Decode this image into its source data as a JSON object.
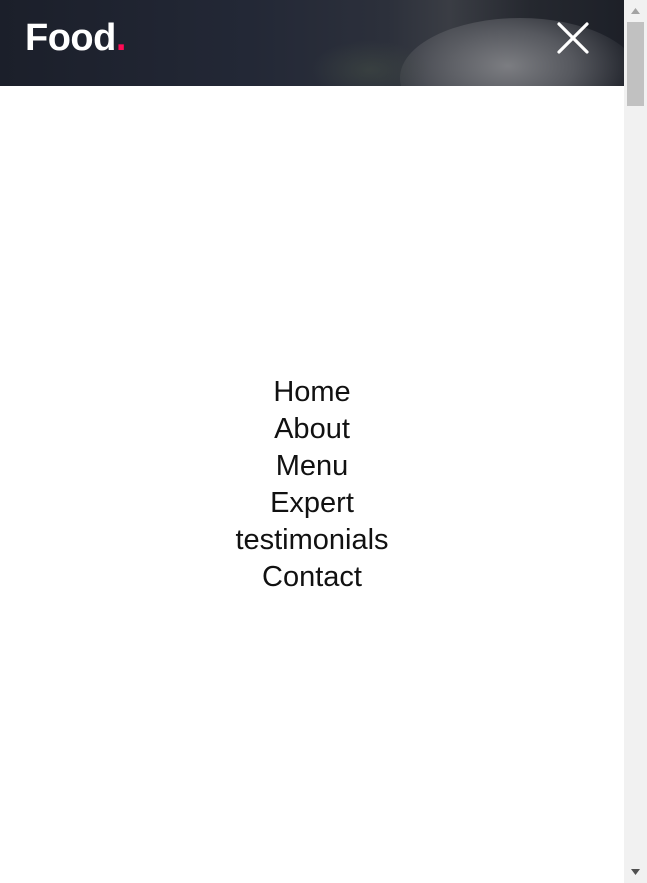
{
  "header": {
    "logo_text": "Food",
    "logo_dot": ".",
    "accent_color": "#ff0b55",
    "close_icon": "close-icon"
  },
  "nav": {
    "items": [
      {
        "label": "Home"
      },
      {
        "label": "About"
      },
      {
        "label": "Menu"
      },
      {
        "label": "Expert"
      },
      {
        "label": "testimonials"
      },
      {
        "label": "Contact"
      }
    ]
  },
  "scrollbar": {
    "up_icon": "triangle-up-icon",
    "down_icon": "triangle-down-icon"
  }
}
